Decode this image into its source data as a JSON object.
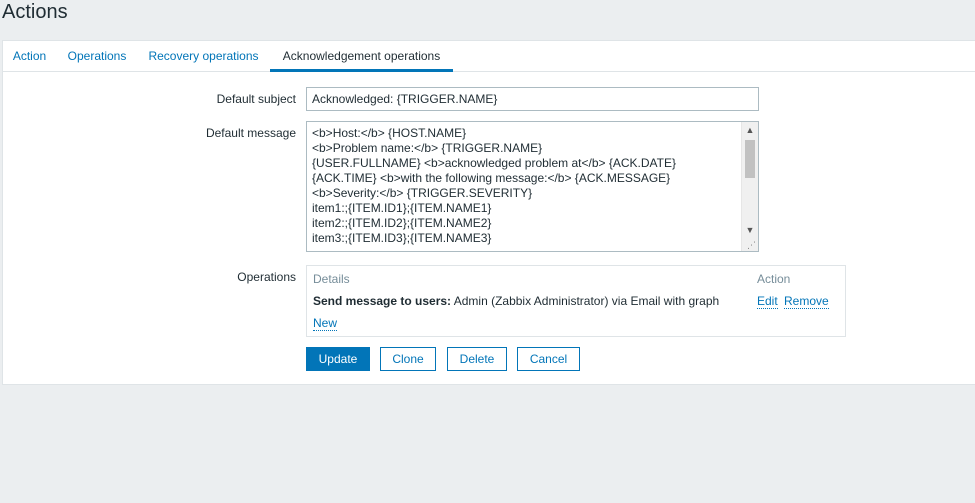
{
  "page": {
    "title": "Actions"
  },
  "tabs": [
    {
      "label": "Action"
    },
    {
      "label": "Operations"
    },
    {
      "label": "Recovery operations"
    },
    {
      "label": "Acknowledgement operations",
      "active": true
    }
  ],
  "form": {
    "subject_label": "Default subject",
    "subject_value": "Acknowledged: {TRIGGER.NAME}",
    "message_label": "Default message",
    "message_lines": [
      "<b>Host:</b> {HOST.NAME}",
      "<b>Problem name:</b> {TRIGGER.NAME}",
      "{USER.FULLNAME} <b>acknowledged problem at</b> {ACK.DATE}",
      "{ACK.TIME} <b>with the following message:</b> {ACK.MESSAGE}",
      "<b>Severity:</b> {TRIGGER.SEVERITY}",
      "item1:;{ITEM.ID1};{ITEM.NAME1}",
      "item2:;{ITEM.ID2};{ITEM.NAME2}",
      "item3:;{ITEM.ID3};{ITEM.NAME3}"
    ],
    "operations_label": "Operations"
  },
  "operations": {
    "col_details": "Details",
    "col_action": "Action",
    "row": {
      "bold": "Send message to users:",
      "text": " Admin (Zabbix Administrator) via Email with graph",
      "edit": "Edit",
      "remove": "Remove"
    },
    "new_link": "New"
  },
  "buttons": {
    "update": "Update",
    "clone": "Clone",
    "delete": "Delete",
    "cancel": "Cancel"
  },
  "colors": {
    "accent": "#0275b8",
    "background": "#ebeef0",
    "text": "#1f2c33",
    "muted": "#768d99"
  }
}
